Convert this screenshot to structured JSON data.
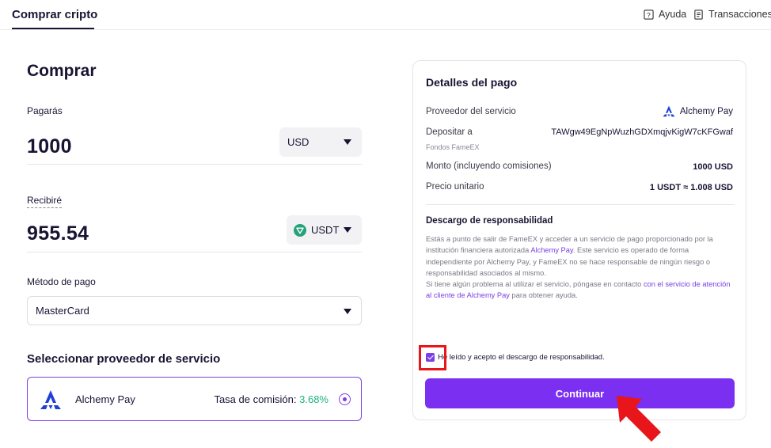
{
  "topbar": {
    "tab": "Comprar cripto",
    "help": "Ayuda",
    "transactions": "Transacciones"
  },
  "buy": {
    "title": "Comprar",
    "pay_label": "Pagarás",
    "pay_amount": "1000",
    "pay_currency": "USD",
    "receive_label": "Recibiré",
    "receive_amount": "955.54",
    "receive_currency": "USDT",
    "method_label": "Método de pago",
    "method_value": "MasterCard",
    "provider_heading": "Seleccionar proveedor de servicio",
    "provider_name": "Alchemy Pay",
    "fee_label": "Tasa de comisión:",
    "fee_value": "3.68%"
  },
  "details": {
    "title": "Detalles del pago",
    "provider_label": "Proveedor del servicio",
    "provider_value": "Alchemy Pay",
    "deposit_label": "Depositar a",
    "deposit_address": "TAWgw49EgNpWuzhGDXmqjvKigW7cKFGwaf",
    "deposit_sub": "Fondos FameEX",
    "amount_label": "Monto (incluyendo comisiones)",
    "amount_value": "1000 USD",
    "price_label": "Precio unitario",
    "price_value": "1 USDT ≈ 1.008 USD",
    "disclaimer_title": "Descargo de responsabilidad",
    "disclaimer_p1a": "Estás a punto de salir de FameEX y acceder a un servicio de pago proporcionado por la institución financiera autorizada ",
    "disclaimer_link1": "Alchemy Pay",
    "disclaimer_p1b": ". Este servicio es operado de forma independiente por Alchemy Pay, y FameEX no se hace responsable de ningún riesgo o responsabilidad asociados al mismo.",
    "disclaimer_p2a": "Si tiene algún problema al utilizar el servicio, póngase en contacto ",
    "disclaimer_link2": "con el servicio de atención al cliente de Alchemy Pay",
    "disclaimer_p2b": " para obtener ayuda.",
    "checkbox_label": "He leído y acepto el descargo de responsabilidad.",
    "checkbox_checked": true,
    "continue": "Continuar"
  },
  "colors": {
    "accent": "#7b2ff0",
    "fee_green": "#1fb37a",
    "tether_green": "#26a17b",
    "annotation_red": "#e8151b",
    "alchemy_blue": "#1f3fd6"
  },
  "icons": [
    "help-icon",
    "document-icon",
    "caret-down-icon",
    "tether-icon",
    "alchemy-pay-logo",
    "radio-selected-icon",
    "checkbox-checked-icon",
    "annotation-arrow"
  ]
}
